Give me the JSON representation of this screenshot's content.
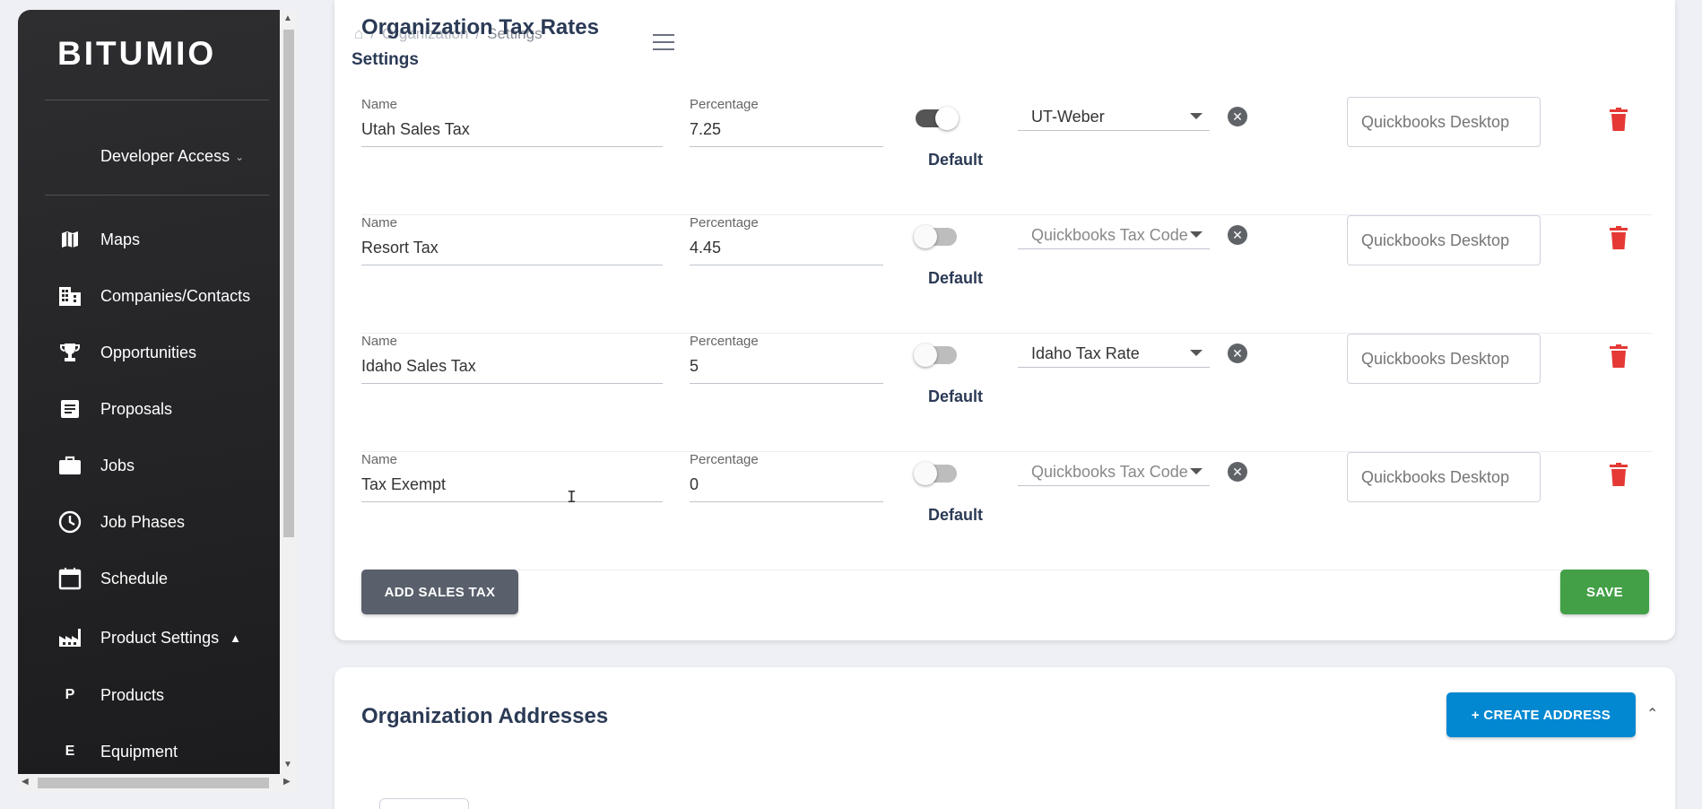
{
  "sidebar": {
    "logo": "BITUMIO",
    "access_label": "Developer Access",
    "items": [
      {
        "label": "Maps",
        "icon": "map-icon"
      },
      {
        "label": "Companies/Contacts",
        "icon": "building-icon"
      },
      {
        "label": "Opportunities",
        "icon": "trophy-icon"
      },
      {
        "label": "Proposals",
        "icon": "document-icon"
      },
      {
        "label": "Jobs",
        "icon": "briefcase-icon"
      },
      {
        "label": "Job Phases",
        "icon": "clock-icon"
      },
      {
        "label": "Schedule",
        "icon": "calendar-icon"
      },
      {
        "label": "Product Settings",
        "icon": "factory-icon"
      },
      {
        "label": "Products",
        "letter": "P"
      },
      {
        "label": "Equipment",
        "letter": "E"
      }
    ]
  },
  "header": {
    "breadcrumb": [
      "Organization",
      "Settings"
    ],
    "page_subtitle": "Settings"
  },
  "tax_rates": {
    "title": "Organization Tax Rates",
    "name_label": "Name",
    "percentage_label": "Percentage",
    "default_label": "Default",
    "qb_placeholder": "Quickbooks Desktop",
    "rows": [
      {
        "name": "Utah Sales Tax",
        "percentage": "7.25",
        "default": true,
        "tax_code": "UT-Weber",
        "tax_code_placeholder": false
      },
      {
        "name": "Resort Tax",
        "percentage": "4.45",
        "default": false,
        "tax_code": "Quickbooks Tax Code",
        "tax_code_placeholder": true
      },
      {
        "name": "Idaho Sales Tax",
        "percentage": "5",
        "default": false,
        "tax_code": "Idaho Tax Rate",
        "tax_code_placeholder": false
      },
      {
        "name": "Tax Exempt",
        "percentage": "0",
        "default": false,
        "tax_code": "Quickbooks Tax Code",
        "tax_code_placeholder": true
      }
    ],
    "add_button": "ADD SALES TAX",
    "save_button": "SAVE"
  },
  "addresses": {
    "title": "Organization Addresses",
    "create_button": "+ CREATE ADDRESS"
  },
  "colors": {
    "sidebar_bg": "#2e2e31",
    "title": "#2b3a55",
    "save": "#43a047",
    "create": "#0288d1",
    "delete": "#e53935"
  }
}
